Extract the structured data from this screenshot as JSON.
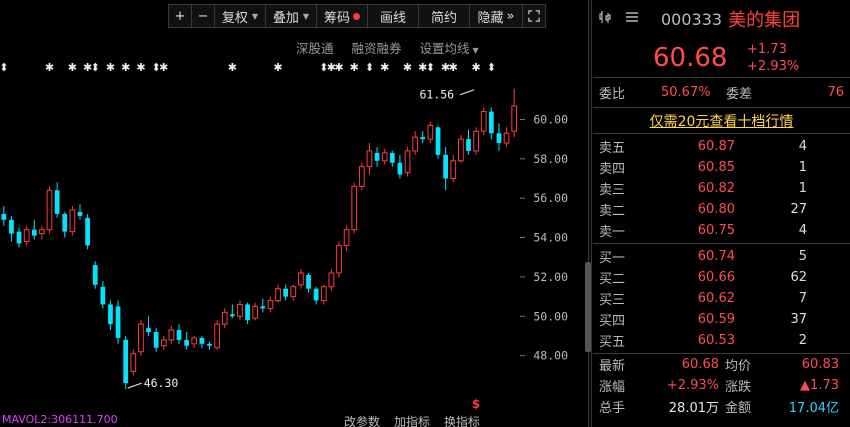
{
  "toolbar": {
    "plus": "+",
    "minus": "−",
    "fuquan": "复权",
    "diejia": "叠加",
    "chouma": "筹码",
    "huaxian": "画线",
    "jianyue": "简约",
    "yincang": "隐藏",
    "more": "»",
    "expand_icon": "expand-icon"
  },
  "subtoolbar": {
    "shengutong": "深股通",
    "rongzi": "融资融券",
    "set_ma": "设置均线"
  },
  "chart_data": {
    "type": "candlestick",
    "y_ticks": [
      "60.00",
      "58.00",
      "56.00",
      "54.00",
      "52.00",
      "50.00",
      "48.00"
    ],
    "ylim": [
      46.0,
      61.8
    ],
    "annotations": [
      {
        "text": "61.56",
        "value": 61.56,
        "index": 62
      },
      {
        "text": "46.30",
        "value": 46.3,
        "index": 16
      }
    ],
    "marker_row": "✱ ✱ ✱ ✱ ✱",
    "candles": [
      [
        55.2,
        55.6,
        54.6,
        54.9
      ],
      [
        54.9,
        55.1,
        53.8,
        54.2
      ],
      [
        54.3,
        54.5,
        53.5,
        53.7
      ],
      [
        53.8,
        54.6,
        53.6,
        54.4
      ],
      [
        54.4,
        54.9,
        53.9,
        54.1
      ],
      [
        54.2,
        54.6,
        53.9,
        54.4
      ],
      [
        54.4,
        56.6,
        54.2,
        56.4
      ],
      [
        56.4,
        56.8,
        55.0,
        55.2
      ],
      [
        55.2,
        55.3,
        54.0,
        54.3
      ],
      [
        54.3,
        55.6,
        54.1,
        55.4
      ],
      [
        55.3,
        55.7,
        54.9,
        55.1
      ],
      [
        55.0,
        55.2,
        53.4,
        53.6
      ],
      [
        52.6,
        52.8,
        51.4,
        51.6
      ],
      [
        51.5,
        51.8,
        50.4,
        50.6
      ],
      [
        50.6,
        50.8,
        49.3,
        49.6
      ],
      [
        50.5,
        50.8,
        48.6,
        48.9
      ],
      [
        48.8,
        49.0,
        46.3,
        46.6
      ],
      [
        47.2,
        48.3,
        47.0,
        48.1
      ],
      [
        48.2,
        49.8,
        48.0,
        49.6
      ],
      [
        49.4,
        50.0,
        49.0,
        49.2
      ],
      [
        49.2,
        49.4,
        48.2,
        48.4
      ],
      [
        48.5,
        49.0,
        48.3,
        48.8
      ],
      [
        48.8,
        49.5,
        48.6,
        49.3
      ],
      [
        49.3,
        49.6,
        48.6,
        48.8
      ],
      [
        48.8,
        49.2,
        48.3,
        48.5
      ],
      [
        48.6,
        49.0,
        48.4,
        48.9
      ],
      [
        48.9,
        49.0,
        48.4,
        48.6
      ],
      [
        48.6,
        48.7,
        48.3,
        48.5
      ],
      [
        48.4,
        49.8,
        48.3,
        49.6
      ],
      [
        49.6,
        50.4,
        49.4,
        50.2
      ],
      [
        50.1,
        50.6,
        49.9,
        50.0
      ],
      [
        50.0,
        50.8,
        49.8,
        50.6
      ],
      [
        50.6,
        50.7,
        49.6,
        49.8
      ],
      [
        49.9,
        50.7,
        49.8,
        50.5
      ],
      [
        50.5,
        50.9,
        50.2,
        50.4
      ],
      [
        50.4,
        51.0,
        50.2,
        50.8
      ],
      [
        50.8,
        51.6,
        50.7,
        51.4
      ],
      [
        51.4,
        51.6,
        50.8,
        51.0
      ],
      [
        51.0,
        51.6,
        50.8,
        51.5
      ],
      [
        51.6,
        52.4,
        51.4,
        52.2
      ],
      [
        52.1,
        52.2,
        51.2,
        51.4
      ],
      [
        51.4,
        51.5,
        50.6,
        50.8
      ],
      [
        50.8,
        51.6,
        50.6,
        51.5
      ],
      [
        51.5,
        52.4,
        51.3,
        52.2
      ],
      [
        52.2,
        53.8,
        52.0,
        53.6
      ],
      [
        53.6,
        54.6,
        53.3,
        54.4
      ],
      [
        54.4,
        56.8,
        54.2,
        56.6
      ],
      [
        56.6,
        57.8,
        56.4,
        57.6
      ],
      [
        57.6,
        58.8,
        57.2,
        58.4
      ],
      [
        58.3,
        58.6,
        57.6,
        57.9
      ],
      [
        57.9,
        58.5,
        57.7,
        58.3
      ],
      [
        58.3,
        58.4,
        57.6,
        57.8
      ],
      [
        57.8,
        58.2,
        57.0,
        57.2
      ],
      [
        57.3,
        58.6,
        57.1,
        58.4
      ],
      [
        58.4,
        59.4,
        58.2,
        59.1
      ],
      [
        59.1,
        59.4,
        58.8,
        59.0
      ],
      [
        59.0,
        59.9,
        58.8,
        59.7
      ],
      [
        59.6,
        59.7,
        58.0,
        58.2
      ],
      [
        58.2,
        58.6,
        56.4,
        57.0
      ],
      [
        57.0,
        58.2,
        56.8,
        57.9
      ],
      [
        57.9,
        59.2,
        57.8,
        59.0
      ],
      [
        59.0,
        59.5,
        58.2,
        58.4
      ],
      [
        58.4,
        59.6,
        58.2,
        59.4
      ],
      [
        59.4,
        60.6,
        59.2,
        60.4
      ],
      [
        60.4,
        60.6,
        59.0,
        59.3
      ],
      [
        59.3,
        59.8,
        58.4,
        58.8
      ],
      [
        58.8,
        59.6,
        58.6,
        59.3
      ],
      [
        59.4,
        61.56,
        59.1,
        60.68
      ]
    ]
  },
  "bottom": {
    "ma_label": "MAVOL2:306111.700",
    "links": [
      "改参数",
      "加指标",
      "换指标"
    ],
    "dollar": "$"
  },
  "quote": {
    "icons": [
      "chart-icon",
      "list-icon"
    ],
    "code": "000333",
    "name": "美的集团",
    "price": "60.68",
    "change": "+1.73",
    "change_pct": "+2.93%",
    "weibi_label": "委比",
    "weibi": "50.67%",
    "weicha_label": "委差",
    "weicha": "76",
    "promo": "仅需20元查看十档行情",
    "asks": [
      {
        "label": "卖五",
        "price": "60.87",
        "vol": "4"
      },
      {
        "label": "卖四",
        "price": "60.85",
        "vol": "1"
      },
      {
        "label": "卖三",
        "price": "60.82",
        "vol": "1"
      },
      {
        "label": "卖二",
        "price": "60.80",
        "vol": "27"
      },
      {
        "label": "卖一",
        "price": "60.75",
        "vol": "4"
      }
    ],
    "bids": [
      {
        "label": "买一",
        "price": "60.74",
        "vol": "5"
      },
      {
        "label": "买二",
        "price": "60.66",
        "vol": "62"
      },
      {
        "label": "买三",
        "price": "60.62",
        "vol": "7"
      },
      {
        "label": "买四",
        "price": "60.59",
        "vol": "37"
      },
      {
        "label": "买五",
        "price": "60.53",
        "vol": "2"
      }
    ],
    "stats": {
      "zuixin_label": "最新",
      "zuixin": "60.68",
      "junjia_label": "均价",
      "junjia": "60.83",
      "zhangfu_label": "涨幅",
      "zhangfu": "+2.93%",
      "zhangdie_label": "涨跌",
      "zhangdie": "▲1.73",
      "zongshou_label": "总手",
      "zongshou": "28.01万",
      "jine_label": "金额",
      "jine": "17.04亿"
    }
  },
  "colors": {
    "up": "#ff3b3b",
    "down": "#00e5ff",
    "accent_red": "#ff4d4d",
    "promo": "#ffd54a"
  }
}
